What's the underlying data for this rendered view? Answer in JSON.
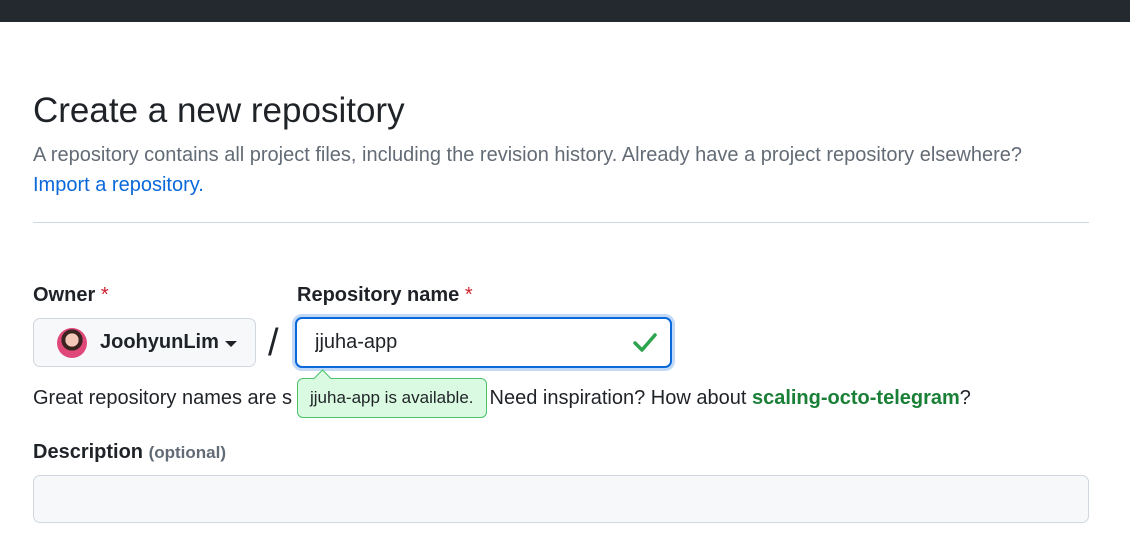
{
  "header": {
    "title": "Create a new repository",
    "subtitle": "A repository contains all project files, including the revision history. Already have a project repository elsewhere?",
    "import_link": "Import a repository."
  },
  "owner": {
    "label": "Owner",
    "required_mark": "*",
    "name": "JoohyunLim",
    "avatar_icon": "user-avatar"
  },
  "separator": "/",
  "repository": {
    "label": "Repository name",
    "required_mark": "*",
    "value": "jjuha-app",
    "check_icon": "check-icon",
    "availability_tooltip": "jjuha-app is available."
  },
  "hint": {
    "prefix": "Great repository names are s",
    "middle": " Need inspiration? How about ",
    "suggestion": "scaling-octo-telegram",
    "suffix": "?"
  },
  "description": {
    "label": "Description",
    "optional_text": "(optional)",
    "value": ""
  },
  "colors": {
    "topbar": "#24292f",
    "link": "#0969da",
    "success": "#1a7f37",
    "required": "#cf222e",
    "focus": "#0969da"
  }
}
